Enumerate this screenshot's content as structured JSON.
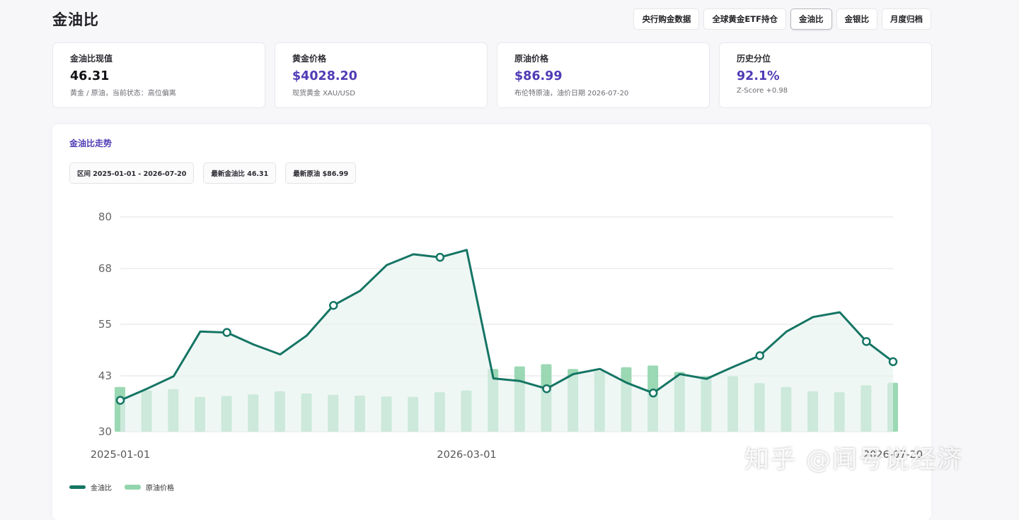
{
  "page": {
    "title": "金油比"
  },
  "nav": {
    "items": [
      {
        "label": "央行购金数据",
        "active": false
      },
      {
        "label": "全球黄金ETF持仓",
        "active": false
      },
      {
        "label": "金油比",
        "active": true
      },
      {
        "label": "金银比",
        "active": false
      },
      {
        "label": "月度归档",
        "active": false
      }
    ]
  },
  "cards": [
    {
      "label": "金油比现值",
      "value": "46.31",
      "sub": "黄金 / 原油，当前状态：高位偏离",
      "accent": false
    },
    {
      "label": "黄金价格",
      "value": "$4028.20",
      "sub": "现货黄金 XAU/USD",
      "accent": true
    },
    {
      "label": "原油价格",
      "value": "$86.99",
      "sub": "布伦特原油，油价日期 2026-07-20",
      "accent": true
    },
    {
      "label": "历史分位",
      "value": "92.1%",
      "sub": "Z-Score +0.98",
      "accent": true
    }
  ],
  "panel": {
    "title": "金油比走势",
    "chips": [
      "区间 2025-01-01 - 2026-07-20",
      "最新金油比 46.31",
      "最新原油 $86.99"
    ]
  },
  "legend": {
    "ratio": "金油比",
    "oil": "原油价格"
  },
  "colors": {
    "line": "#157564",
    "bar": "#93d5ae",
    "area": "#e6f3ef",
    "accent": "#4f3cb5"
  },
  "watermark": "知乎 @闻号说经济",
  "chart_data": {
    "type": "line",
    "ylim": [
      30,
      80
    ],
    "yticks": [
      30,
      43,
      55,
      68,
      80
    ],
    "xtick_labels": [
      {
        "index": 0,
        "label": "2025-01-01"
      },
      {
        "index": 13,
        "label": "2026-03-01"
      },
      {
        "index": 29,
        "label": "2026-07-20"
      }
    ],
    "series": [
      {
        "name": "金油比",
        "kind": "line",
        "values": [
          37.3,
          40.0,
          42.9,
          53.3,
          53.1,
          50.3,
          48.0,
          52.4,
          59.4,
          62.8,
          68.8,
          71.3,
          70.6,
          72.3,
          42.4,
          41.8,
          40.0,
          43.4,
          44.6,
          41.4,
          39.0,
          43.4,
          42.3,
          45.1,
          47.7,
          53.3,
          56.7,
          57.8,
          51.0,
          46.3
        ],
        "markers": [
          0,
          4,
          8,
          12,
          16,
          20,
          24,
          28,
          29
        ]
      },
      {
        "name": "原油价格",
        "kind": "bar",
        "values": [
          40.4,
          39.6,
          39.9,
          38.1,
          38.3,
          38.7,
          39.4,
          38.9,
          38.6,
          38.4,
          38.2,
          38.1,
          39.2,
          39.6,
          44.6,
          45.2,
          45.7,
          44.6,
          44.1,
          45.0,
          45.4,
          43.9,
          42.9,
          42.9,
          41.3,
          40.4,
          39.4,
          39.2,
          40.8,
          41.4
        ]
      }
    ]
  }
}
